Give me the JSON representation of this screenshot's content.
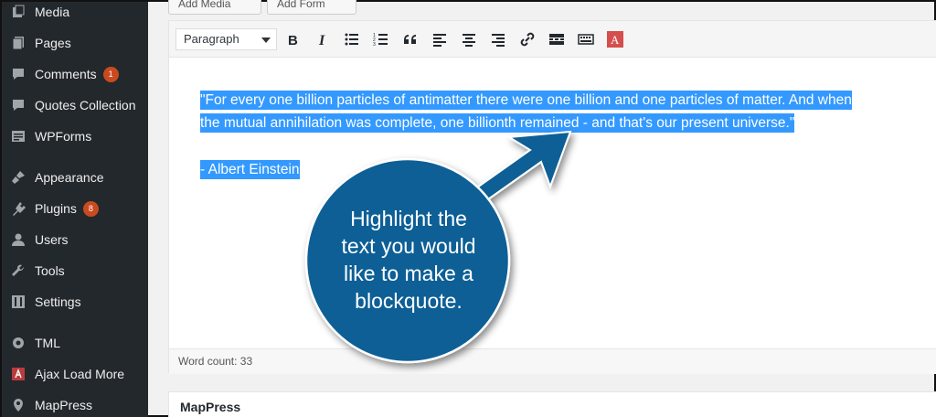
{
  "sidebar": {
    "items": [
      {
        "label": "Media",
        "icon": "media-icon",
        "badge": ""
      },
      {
        "label": "Pages",
        "icon": "pages-icon",
        "badge": ""
      },
      {
        "label": "Comments",
        "icon": "comments-icon",
        "badge": "1"
      },
      {
        "label": "Quotes Collection",
        "icon": "quotes-icon",
        "badge": ""
      },
      {
        "label": "WPForms",
        "icon": "wpforms-icon",
        "badge": ""
      },
      {
        "label": "Appearance",
        "icon": "appearance-icon",
        "badge": ""
      },
      {
        "label": "Plugins",
        "icon": "plugins-icon",
        "badge": "8"
      },
      {
        "label": "Users",
        "icon": "users-icon",
        "badge": ""
      },
      {
        "label": "Tools",
        "icon": "tools-icon",
        "badge": ""
      },
      {
        "label": "Settings",
        "icon": "settings-icon",
        "badge": ""
      },
      {
        "label": "TML",
        "icon": "gear-icon",
        "badge": ""
      },
      {
        "label": "Ajax Load More",
        "icon": "ajax-load-more-icon",
        "badge": ""
      },
      {
        "label": "MapPress",
        "icon": "map-pin-icon",
        "badge": ""
      }
    ]
  },
  "media_buttons": {
    "add_media": "Add Media",
    "add_form": "Add Form"
  },
  "toolbar": {
    "format_value": "Paragraph",
    "buttons": [
      "bold-icon",
      "italic-icon",
      "bullet-list-icon",
      "numbered-list-icon",
      "blockquote-icon",
      "align-left-icon",
      "align-center-icon",
      "align-right-icon",
      "link-icon",
      "read-more-icon",
      "toolbar-toggle-icon",
      "text-color-icon"
    ]
  },
  "content": {
    "line1": "\"For every one billion particles of antimatter there were one billion and one particles of matter. And when",
    "line2": "the mutual annihilation was complete, one billionth remained - and that's our present universe.\"",
    "line3": "- Albert Einstein"
  },
  "status": {
    "word_count": "Word count: 33"
  },
  "metabox": {
    "title": "MapPress"
  },
  "callout": {
    "lines": [
      "Highlight the",
      "text you would",
      "like to make a",
      "blockquote."
    ],
    "color": "#0e5f96"
  },
  "colors": {
    "sidebar_bg": "#23282d",
    "badge": "#ca4a1f",
    "selection": "#3399ff"
  }
}
